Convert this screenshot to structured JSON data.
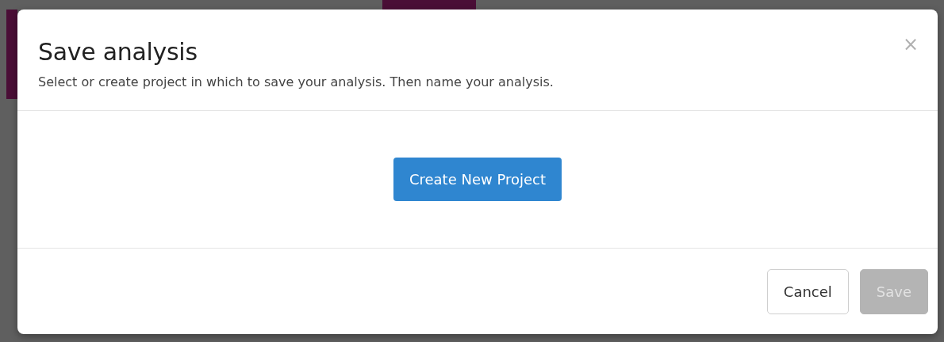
{
  "dialog": {
    "title": "Save analysis",
    "subtitle": "Select or create project in which to save your analysis. Then name your analysis.",
    "close": "×",
    "create_button": "Create New Project",
    "buttons": [
      {
        "label": "Cancel",
        "kind": "secondary",
        "disabled": false
      },
      {
        "label": "Save",
        "kind": "primary",
        "disabled": true
      }
    ]
  }
}
